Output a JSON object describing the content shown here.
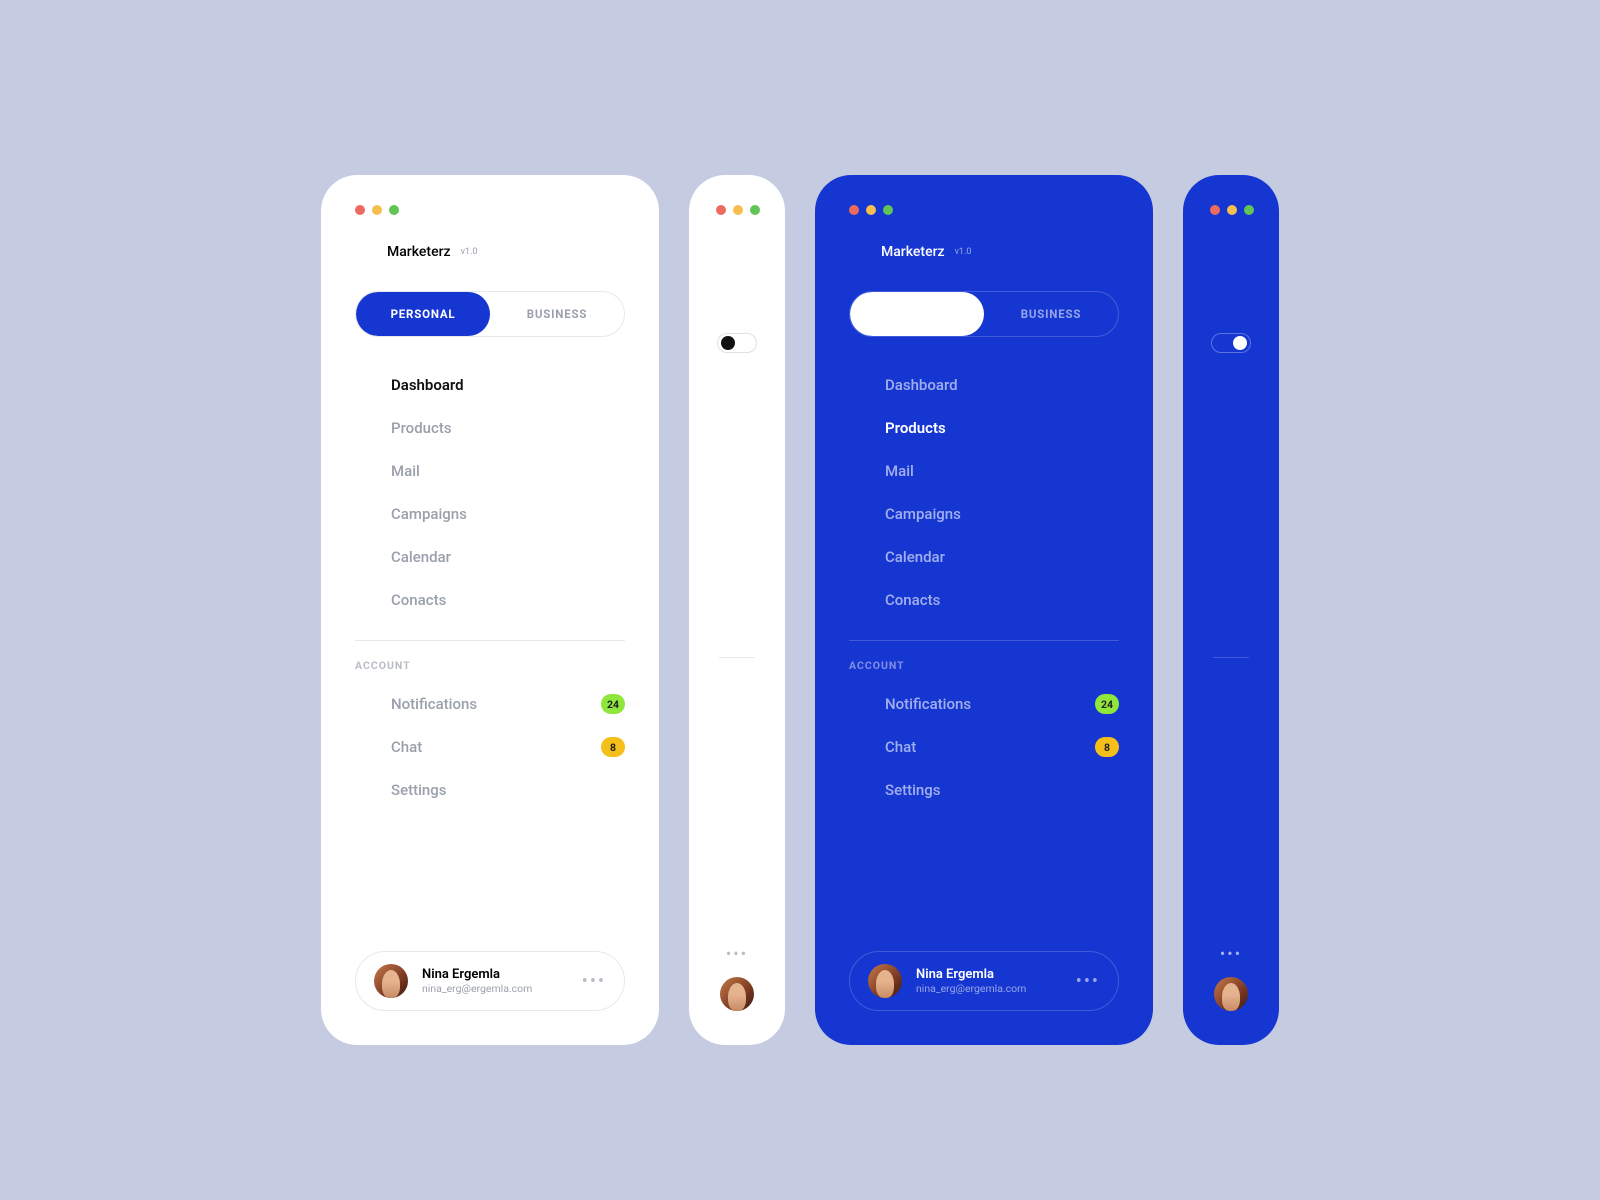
{
  "app": {
    "name": "Marketerz",
    "version": "v1.0"
  },
  "tabs": {
    "personal": "PERSONAL",
    "business": "BUSINESS"
  },
  "nav": [
    {
      "key": "dashboard",
      "label": "Dashboard"
    },
    {
      "key": "products",
      "label": "Products"
    },
    {
      "key": "mail",
      "label": "Mail"
    },
    {
      "key": "campaigns",
      "label": "Campaigns"
    },
    {
      "key": "calendar",
      "label": "Calendar"
    },
    {
      "key": "contacts",
      "label": "Conacts"
    }
  ],
  "section": {
    "account": "ACCOUNT"
  },
  "account_nav": [
    {
      "key": "notifications",
      "label": "Notifications",
      "badge": "24",
      "badge_color": "green"
    },
    {
      "key": "chat",
      "label": "Chat",
      "badge": "8",
      "badge_color": "orange"
    },
    {
      "key": "settings",
      "label": "Settings"
    }
  ],
  "profile": {
    "name": "Nina Ergemla",
    "email": "nina_erg@ergemla.com"
  },
  "variants": {
    "light_wide": {
      "active_nav": "dashboard",
      "active_tab_style": "blue"
    },
    "light_narrow": {
      "active_nav": "dashboard",
      "toggle": "left"
    },
    "dark_wide": {
      "active_nav": "products",
      "active_tab_style": "white"
    },
    "dark_narrow": {
      "active_nav": "products",
      "toggle": "right"
    }
  },
  "colors": {
    "primary": "#1636d1",
    "badge_green": "#90e73b",
    "badge_orange": "#f5bf1a"
  }
}
